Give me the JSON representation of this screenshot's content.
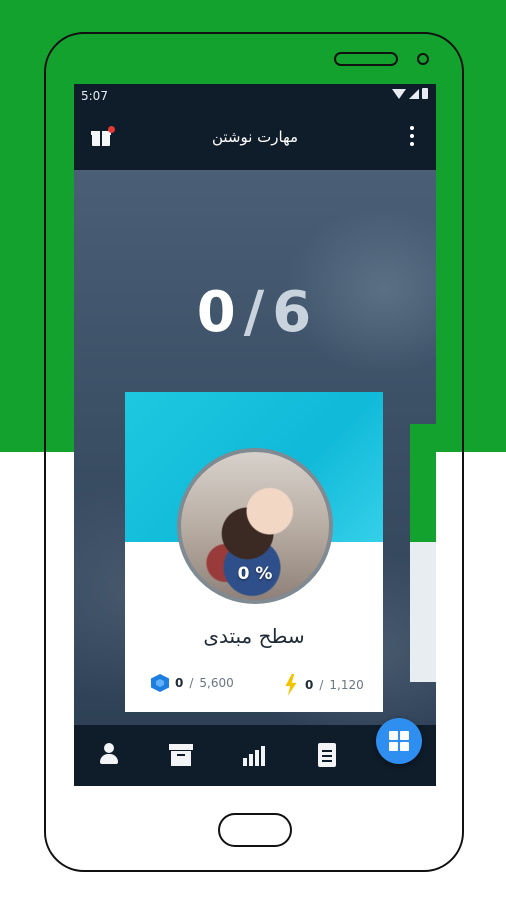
{
  "status_bar": {
    "time": "5:07"
  },
  "app_bar": {
    "title": "مهارت نوشتن"
  },
  "progress": {
    "completed": "0",
    "separator": "/",
    "total": "6"
  },
  "level_card": {
    "percent_label": "0 %",
    "level_name": "سطح مبتدی",
    "gems": {
      "current": "0",
      "separator": "/",
      "max": "5,600"
    },
    "xp": {
      "current": "0",
      "separator": "/",
      "max": "1,120"
    }
  },
  "bottom_nav": {
    "items": [
      {
        "icon": "person-icon"
      },
      {
        "icon": "archive-icon"
      },
      {
        "icon": "chart-icon"
      },
      {
        "icon": "clipboard-icon"
      }
    ]
  },
  "fab": {
    "icon": "grid-icon"
  },
  "colors": {
    "accent": "#2f8ff0",
    "app_bar": "#0f1c2a",
    "card_header": "#10b9d8",
    "background_green": "#13a22e",
    "notification_dot": "#e53935",
    "xp_bolt": "#f2c300",
    "gem": "#1e7de0"
  }
}
